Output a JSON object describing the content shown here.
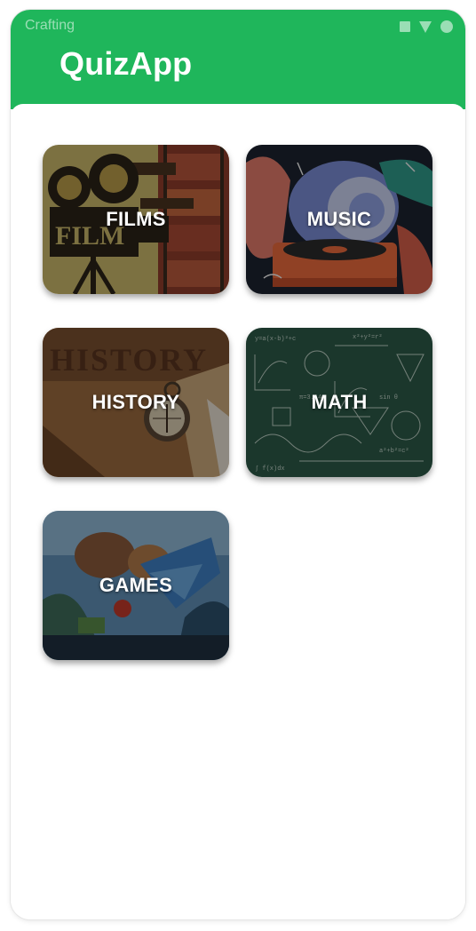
{
  "status_bar": {
    "app_label": "Crafting",
    "icons": [
      "square-icon",
      "wifi-triangle-icon",
      "circle-icon"
    ]
  },
  "header": {
    "title": "QuizApp",
    "color": "#1fb65b"
  },
  "categories": [
    {
      "label": "FILMS",
      "icon": "film-camera-image"
    },
    {
      "label": "MUSIC",
      "icon": "gramophone-image"
    },
    {
      "label": "HISTORY",
      "icon": "compass-map-image"
    },
    {
      "label": "MATH",
      "icon": "chalkboard-equations-image"
    },
    {
      "label": "GAMES",
      "icon": "fantasy-game-art-image"
    }
  ]
}
